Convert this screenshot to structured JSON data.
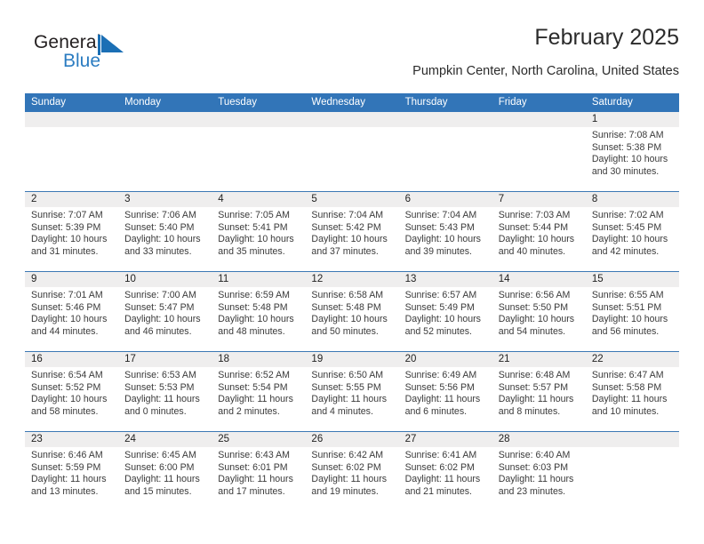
{
  "brand": {
    "name_top": "General",
    "name_bottom": "Blue",
    "flag_icon": "triangle-flag-icon",
    "color_dark": "#231f20",
    "color_blue": "#2b7cc1"
  },
  "header": {
    "title": "February 2025",
    "subtitle": "Pumpkin Center, North Carolina, United States"
  },
  "colors": {
    "header_blue": "#3275b8",
    "row_separator": "#3c78b4",
    "date_band": "#efeeee",
    "text": "#222222"
  },
  "calendar": {
    "weekday_headers": [
      "Sunday",
      "Monday",
      "Tuesday",
      "Wednesday",
      "Thursday",
      "Friday",
      "Saturday"
    ],
    "weeks": [
      {
        "days": [
          {
            "num": "",
            "lines": []
          },
          {
            "num": "",
            "lines": []
          },
          {
            "num": "",
            "lines": []
          },
          {
            "num": "",
            "lines": []
          },
          {
            "num": "",
            "lines": []
          },
          {
            "num": "",
            "lines": []
          },
          {
            "num": "1",
            "lines": [
              "Sunrise: 7:08 AM",
              "Sunset: 5:38 PM",
              "Daylight: 10 hours",
              "and 30 minutes."
            ]
          }
        ]
      },
      {
        "days": [
          {
            "num": "2",
            "lines": [
              "Sunrise: 7:07 AM",
              "Sunset: 5:39 PM",
              "Daylight: 10 hours",
              "and 31 minutes."
            ]
          },
          {
            "num": "3",
            "lines": [
              "Sunrise: 7:06 AM",
              "Sunset: 5:40 PM",
              "Daylight: 10 hours",
              "and 33 minutes."
            ]
          },
          {
            "num": "4",
            "lines": [
              "Sunrise: 7:05 AM",
              "Sunset: 5:41 PM",
              "Daylight: 10 hours",
              "and 35 minutes."
            ]
          },
          {
            "num": "5",
            "lines": [
              "Sunrise: 7:04 AM",
              "Sunset: 5:42 PM",
              "Daylight: 10 hours",
              "and 37 minutes."
            ]
          },
          {
            "num": "6",
            "lines": [
              "Sunrise: 7:04 AM",
              "Sunset: 5:43 PM",
              "Daylight: 10 hours",
              "and 39 minutes."
            ]
          },
          {
            "num": "7",
            "lines": [
              "Sunrise: 7:03 AM",
              "Sunset: 5:44 PM",
              "Daylight: 10 hours",
              "and 40 minutes."
            ]
          },
          {
            "num": "8",
            "lines": [
              "Sunrise: 7:02 AM",
              "Sunset: 5:45 PM",
              "Daylight: 10 hours",
              "and 42 minutes."
            ]
          }
        ]
      },
      {
        "days": [
          {
            "num": "9",
            "lines": [
              "Sunrise: 7:01 AM",
              "Sunset: 5:46 PM",
              "Daylight: 10 hours",
              "and 44 minutes."
            ]
          },
          {
            "num": "10",
            "lines": [
              "Sunrise: 7:00 AM",
              "Sunset: 5:47 PM",
              "Daylight: 10 hours",
              "and 46 minutes."
            ]
          },
          {
            "num": "11",
            "lines": [
              "Sunrise: 6:59 AM",
              "Sunset: 5:48 PM",
              "Daylight: 10 hours",
              "and 48 minutes."
            ]
          },
          {
            "num": "12",
            "lines": [
              "Sunrise: 6:58 AM",
              "Sunset: 5:48 PM",
              "Daylight: 10 hours",
              "and 50 minutes."
            ]
          },
          {
            "num": "13",
            "lines": [
              "Sunrise: 6:57 AM",
              "Sunset: 5:49 PM",
              "Daylight: 10 hours",
              "and 52 minutes."
            ]
          },
          {
            "num": "14",
            "lines": [
              "Sunrise: 6:56 AM",
              "Sunset: 5:50 PM",
              "Daylight: 10 hours",
              "and 54 minutes."
            ]
          },
          {
            "num": "15",
            "lines": [
              "Sunrise: 6:55 AM",
              "Sunset: 5:51 PM",
              "Daylight: 10 hours",
              "and 56 minutes."
            ]
          }
        ]
      },
      {
        "days": [
          {
            "num": "16",
            "lines": [
              "Sunrise: 6:54 AM",
              "Sunset: 5:52 PM",
              "Daylight: 10 hours",
              "and 58 minutes."
            ]
          },
          {
            "num": "17",
            "lines": [
              "Sunrise: 6:53 AM",
              "Sunset: 5:53 PM",
              "Daylight: 11 hours",
              "and 0 minutes."
            ]
          },
          {
            "num": "18",
            "lines": [
              "Sunrise: 6:52 AM",
              "Sunset: 5:54 PM",
              "Daylight: 11 hours",
              "and 2 minutes."
            ]
          },
          {
            "num": "19",
            "lines": [
              "Sunrise: 6:50 AM",
              "Sunset: 5:55 PM",
              "Daylight: 11 hours",
              "and 4 minutes."
            ]
          },
          {
            "num": "20",
            "lines": [
              "Sunrise: 6:49 AM",
              "Sunset: 5:56 PM",
              "Daylight: 11 hours",
              "and 6 minutes."
            ]
          },
          {
            "num": "21",
            "lines": [
              "Sunrise: 6:48 AM",
              "Sunset: 5:57 PM",
              "Daylight: 11 hours",
              "and 8 minutes."
            ]
          },
          {
            "num": "22",
            "lines": [
              "Sunrise: 6:47 AM",
              "Sunset: 5:58 PM",
              "Daylight: 11 hours",
              "and 10 minutes."
            ]
          }
        ]
      },
      {
        "days": [
          {
            "num": "23",
            "lines": [
              "Sunrise: 6:46 AM",
              "Sunset: 5:59 PM",
              "Daylight: 11 hours",
              "and 13 minutes."
            ]
          },
          {
            "num": "24",
            "lines": [
              "Sunrise: 6:45 AM",
              "Sunset: 6:00 PM",
              "Daylight: 11 hours",
              "and 15 minutes."
            ]
          },
          {
            "num": "25",
            "lines": [
              "Sunrise: 6:43 AM",
              "Sunset: 6:01 PM",
              "Daylight: 11 hours",
              "and 17 minutes."
            ]
          },
          {
            "num": "26",
            "lines": [
              "Sunrise: 6:42 AM",
              "Sunset: 6:02 PM",
              "Daylight: 11 hours",
              "and 19 minutes."
            ]
          },
          {
            "num": "27",
            "lines": [
              "Sunrise: 6:41 AM",
              "Sunset: 6:02 PM",
              "Daylight: 11 hours",
              "and 21 minutes."
            ]
          },
          {
            "num": "28",
            "lines": [
              "Sunrise: 6:40 AM",
              "Sunset: 6:03 PM",
              "Daylight: 11 hours",
              "and 23 minutes."
            ]
          },
          {
            "num": "",
            "lines": []
          }
        ]
      }
    ]
  }
}
